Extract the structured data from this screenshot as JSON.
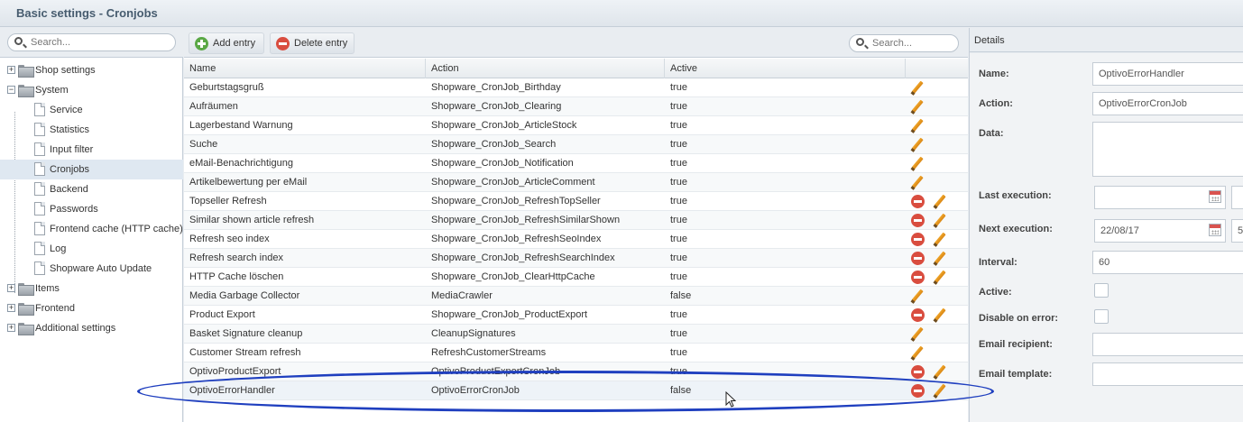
{
  "window": {
    "title": "Basic settings - Cronjobs"
  },
  "sidebar": {
    "search_placeholder": "Search...",
    "items": [
      {
        "label": "Shop settings",
        "kind": "folder",
        "level": 0,
        "expanded": false
      },
      {
        "label": "System",
        "kind": "folder",
        "level": 0,
        "expanded": true
      },
      {
        "label": "Service",
        "kind": "file",
        "level": 1
      },
      {
        "label": "Statistics",
        "kind": "file",
        "level": 1
      },
      {
        "label": "Input filter",
        "kind": "file",
        "level": 1
      },
      {
        "label": "Cronjobs",
        "kind": "file",
        "level": 1,
        "selected": true
      },
      {
        "label": "Backend",
        "kind": "file",
        "level": 1
      },
      {
        "label": "Passwords",
        "kind": "file",
        "level": 1
      },
      {
        "label": "Frontend cache (HTTP cache)",
        "kind": "file",
        "level": 1
      },
      {
        "label": "Log",
        "kind": "file",
        "level": 1
      },
      {
        "label": "Shopware Auto Update",
        "kind": "file",
        "level": 1
      },
      {
        "label": "Items",
        "kind": "folder",
        "level": 0,
        "expanded": false
      },
      {
        "label": "Frontend",
        "kind": "folder",
        "level": 0,
        "expanded": false
      },
      {
        "label": "Additional settings",
        "kind": "folder",
        "level": 0,
        "expanded": false
      }
    ]
  },
  "toolbar": {
    "add_label": "Add entry",
    "delete_label": "Delete entry",
    "search_placeholder": "Search..."
  },
  "grid": {
    "columns": [
      "Name",
      "Action",
      "Active"
    ],
    "rows": [
      {
        "name": "Geburtstagsgruß",
        "action": "Shopware_CronJob_Birthday",
        "active": "true",
        "deletable": false
      },
      {
        "name": "Aufräumen",
        "action": "Shopware_CronJob_Clearing",
        "active": "true",
        "deletable": false
      },
      {
        "name": "Lagerbestand Warnung",
        "action": "Shopware_CronJob_ArticleStock",
        "active": "true",
        "deletable": false
      },
      {
        "name": "Suche",
        "action": "Shopware_CronJob_Search",
        "active": "true",
        "deletable": false
      },
      {
        "name": "eMail-Benachrichtigung",
        "action": "Shopware_CronJob_Notification",
        "active": "true",
        "deletable": false
      },
      {
        "name": "Artikelbewertung per eMail",
        "action": "Shopware_CronJob_ArticleComment",
        "active": "true",
        "deletable": false
      },
      {
        "name": "Topseller Refresh",
        "action": "Shopware_CronJob_RefreshTopSeller",
        "active": "true",
        "deletable": true
      },
      {
        "name": "Similar shown article refresh",
        "action": "Shopware_CronJob_RefreshSimilarShown",
        "active": "true",
        "deletable": true
      },
      {
        "name": "Refresh seo index",
        "action": "Shopware_CronJob_RefreshSeoIndex",
        "active": "true",
        "deletable": true
      },
      {
        "name": "Refresh search index",
        "action": "Shopware_CronJob_RefreshSearchIndex",
        "active": "true",
        "deletable": true
      },
      {
        "name": "HTTP Cache löschen",
        "action": "Shopware_CronJob_ClearHttpCache",
        "active": "true",
        "deletable": true
      },
      {
        "name": "Media Garbage Collector",
        "action": "MediaCrawler",
        "active": "false",
        "deletable": false
      },
      {
        "name": "Product Export",
        "action": "Shopware_CronJob_ProductExport",
        "active": "true",
        "deletable": true
      },
      {
        "name": "Basket Signature cleanup",
        "action": "CleanupSignatures",
        "active": "true",
        "deletable": false
      },
      {
        "name": "Customer Stream refresh",
        "action": "RefreshCustomerStreams",
        "active": "true",
        "deletable": false
      },
      {
        "name": "OptivoProductExport",
        "action": "OptivoProductExportCronJob",
        "active": "true",
        "deletable": true
      },
      {
        "name": "OptivoErrorHandler",
        "action": "OptivoErrorCronJob",
        "active": "false",
        "deletable": true,
        "selected": true
      }
    ]
  },
  "details": {
    "title": "Details",
    "fields": {
      "name_label": "Name:",
      "name_value": "OptivoErrorHandler",
      "action_label": "Action:",
      "action_value": "OptivoErrorCronJob",
      "data_label": "Data:",
      "data_value": "",
      "last_exec_label": "Last execution:",
      "last_exec_date": "",
      "next_exec_label": "Next execution:",
      "next_exec_date": "22/08/17",
      "next_exec_time": "5",
      "interval_label": "Interval:",
      "interval_value": "60",
      "active_label": "Active:",
      "disable_label": "Disable on error:",
      "email_recipient_label": "Email recipient:",
      "email_recipient_value": "",
      "email_template_label": "Email template:",
      "email_template_value": ""
    }
  },
  "colors": {
    "annotation": "#1f3fbf",
    "delete": "#d94d3f",
    "add": "#5aa845",
    "edit": "#f0a62a"
  }
}
